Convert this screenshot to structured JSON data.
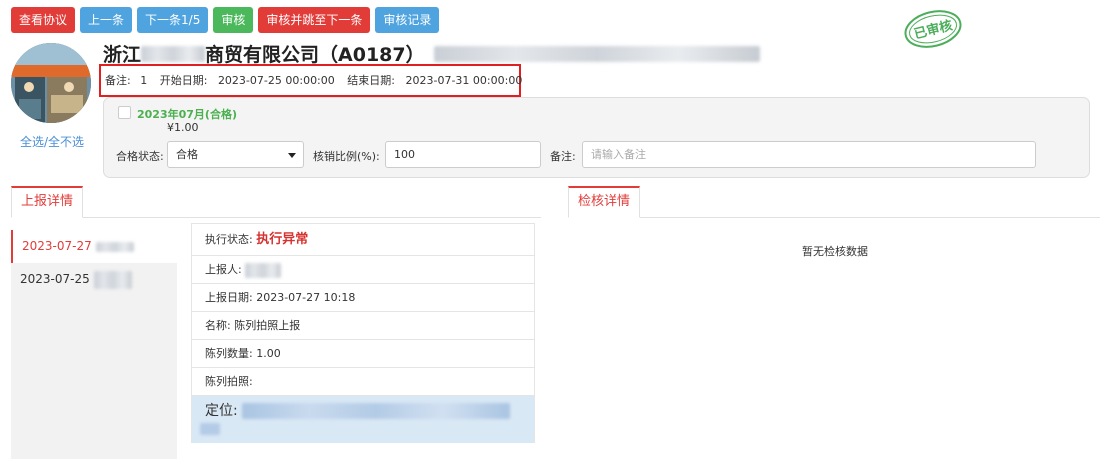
{
  "toolbar": {
    "view_agreement": "查看协议",
    "prev": "上一条",
    "next": "下一条1/5",
    "audit": "审核",
    "audit_next": "审核并跳至下一条",
    "audit_log": "审核记录"
  },
  "stamp": {
    "text": "已审核"
  },
  "company": {
    "name_prefix": "浙江",
    "name_suffix": "商贸有限公司（A0187）"
  },
  "remark": {
    "label": "备注:",
    "value": "1",
    "start_label": "开始日期:",
    "start_value": "2023-07-25 00:00:00",
    "end_label": "结束日期:",
    "end_value": "2023-07-31 00:00:00"
  },
  "select_all": "全选/全不选",
  "month": {
    "title": "2023年07月(合格)",
    "price": "¥1.00",
    "status_label": "合格状态:",
    "status_value": "合格",
    "ratio_label": "核销比例(%):",
    "ratio_value": "100",
    "note_label": "备注:",
    "note_placeholder": "请输入备注"
  },
  "tabs": {
    "report": "上报详情",
    "check": "检核详情"
  },
  "dates": [
    "2023-07-27",
    "2023-07-25"
  ],
  "detail": {
    "status_label": "执行状态:",
    "status_value": "执行异常",
    "reporter_label": "上报人:",
    "date_label": "上报日期:",
    "date_value": "2023-07-27 10:18",
    "name_label": "名称:",
    "name_value": "陈列拍照上报",
    "qty_label": "陈列数量:",
    "qty_value": "1.00",
    "photo_label": "陈列拍照:",
    "location_label": "定位:"
  },
  "check": {
    "empty": "暂无检核数据"
  },
  "colors": {
    "red": "#e23c39",
    "blue": "#4fa3df",
    "green": "#4cb85c",
    "stamp": "#4cae5a"
  }
}
